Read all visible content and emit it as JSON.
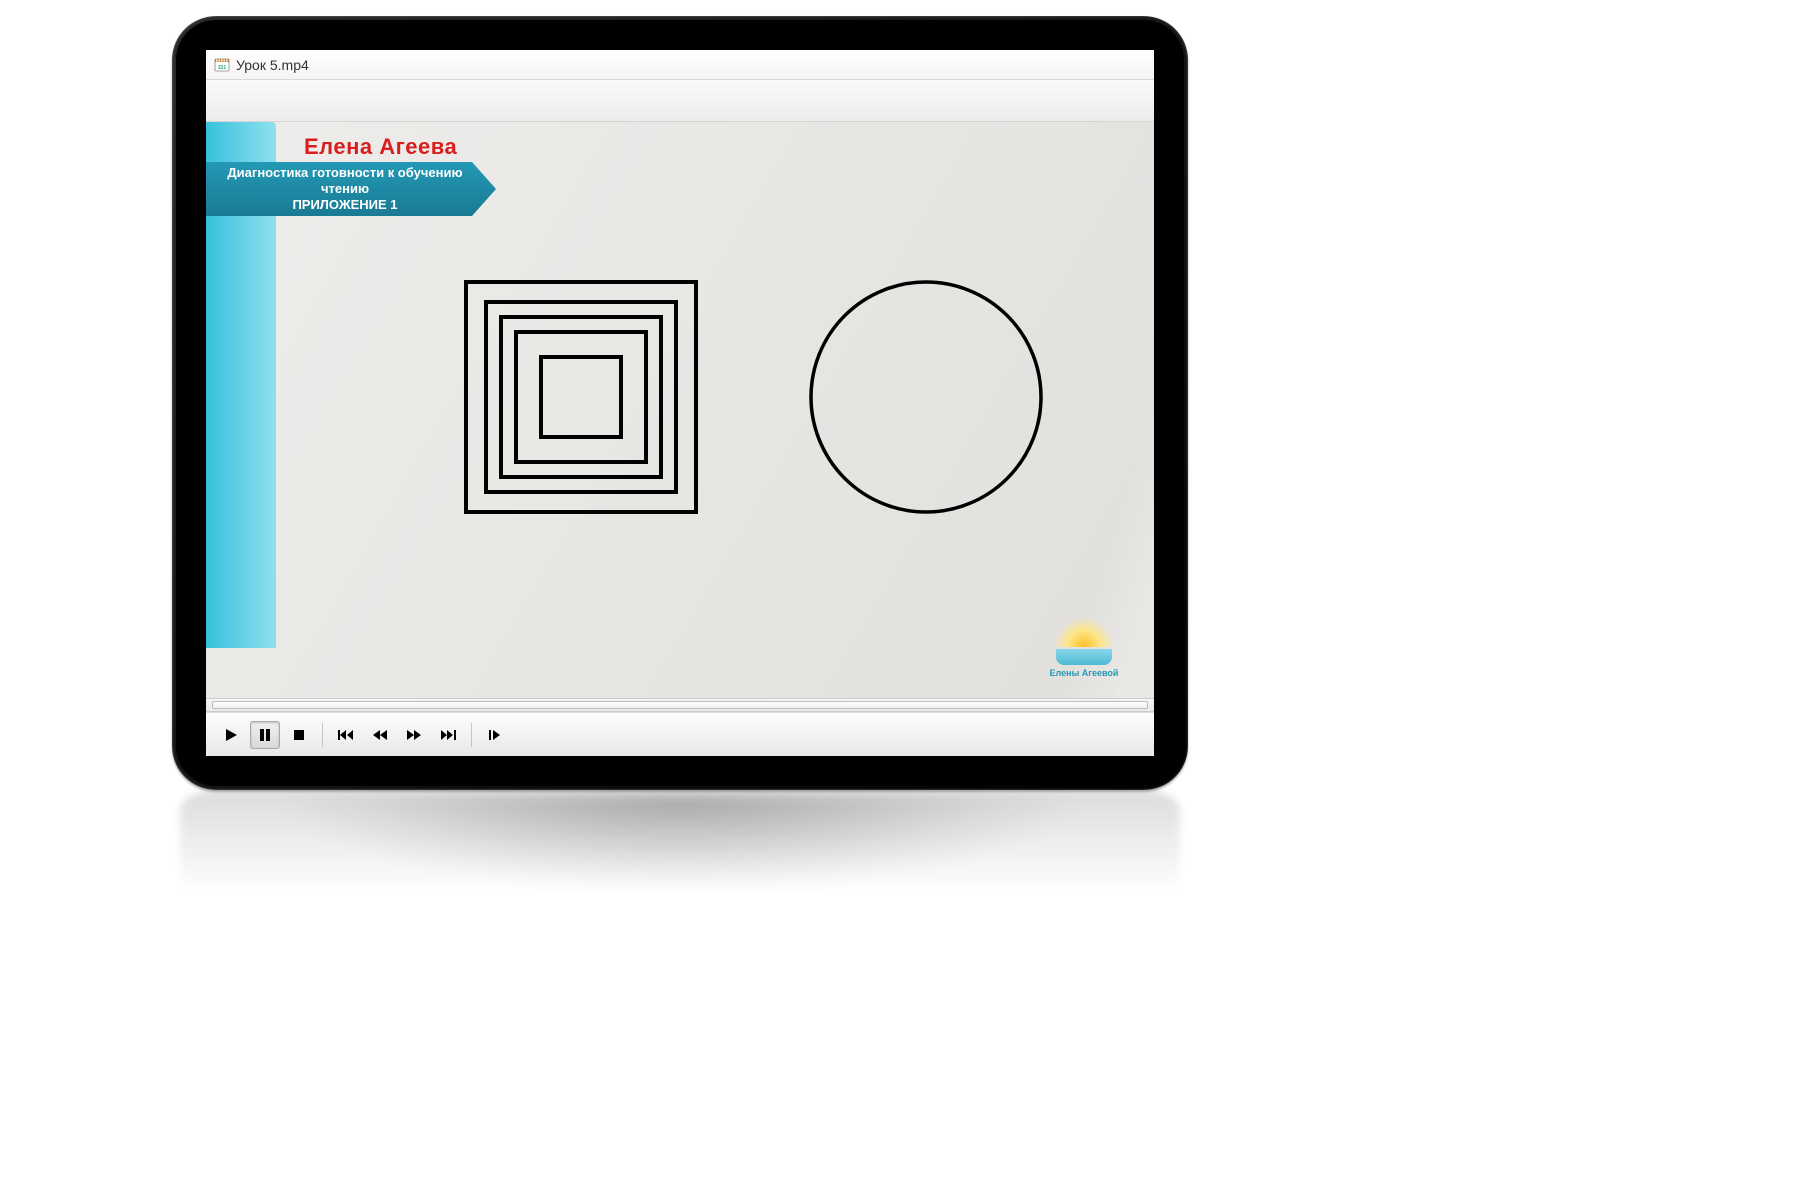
{
  "window": {
    "title": "Урок 5.mp4"
  },
  "slide": {
    "author": "Елена Агеева",
    "banner_line1": "Диагностика готовности к обучению чтению",
    "banner_line2": "ПРИЛОЖЕНИЕ 1",
    "logo_text": "Елены Агеевой"
  },
  "player": {
    "state": "paused"
  },
  "colors": {
    "accent_cyan": "#2399b5",
    "author_red": "#d81f1f"
  }
}
